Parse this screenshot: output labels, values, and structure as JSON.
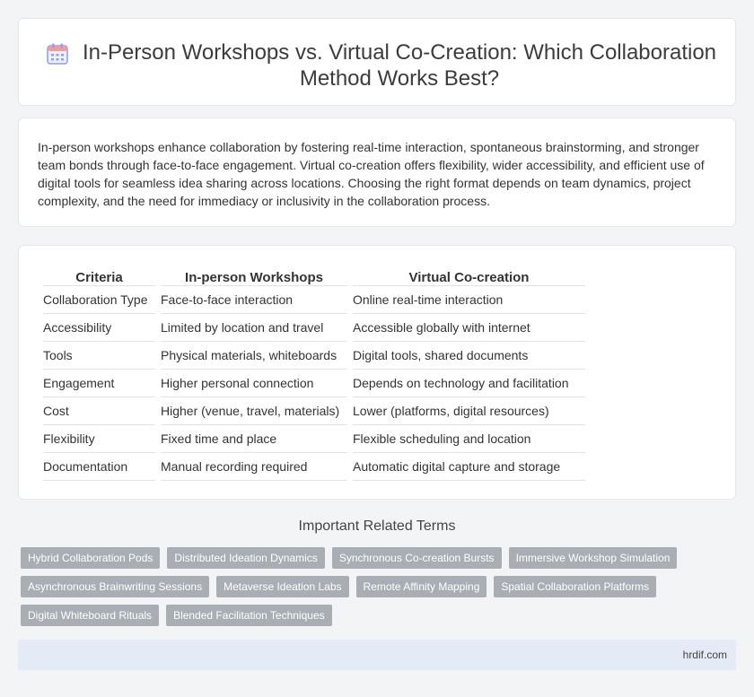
{
  "header": {
    "title": "In-Person Workshops vs. Virtual Co-Creation: Which Collaboration Method Works Best?",
    "icon": "calendar-icon"
  },
  "summary": {
    "text": "In-person workshops enhance collaboration by fostering real-time interaction, spontaneous brainstorming, and stronger team bonds through face-to-face engagement. Virtual co-creation offers flexibility, wider accessibility, and efficient use of digital tools for seamless idea sharing across locations. Choosing the right format depends on team dynamics, project complexity, and the need for immediacy or inclusivity in the collaboration process."
  },
  "table": {
    "headers": [
      "Criteria",
      "In-person Workshops",
      "Virtual Co-creation"
    ],
    "rows": [
      [
        "Collaboration Type",
        "Face-to-face interaction",
        "Online real-time interaction"
      ],
      [
        "Accessibility",
        "Limited by location and travel",
        "Accessible globally with internet"
      ],
      [
        "Tools",
        "Physical materials, whiteboards",
        "Digital tools, shared documents"
      ],
      [
        "Engagement",
        "Higher personal connection",
        "Depends on technology and facilitation"
      ],
      [
        "Cost",
        "Higher (venue, travel, materials)",
        "Lower (platforms, digital resources)"
      ],
      [
        "Flexibility",
        "Fixed time and place",
        "Flexible scheduling and location"
      ],
      [
        "Documentation",
        "Manual recording required",
        "Automatic digital capture and storage"
      ]
    ]
  },
  "related": {
    "title": "Important Related Terms",
    "tags": [
      [
        "Hybrid Collaboration Pods",
        "Distributed Ideation Dynamics",
        "Synchronous Co-creation Bursts",
        "Immersive Workshop Simulation"
      ],
      [
        "Asynchronous Brainwriting Sessions",
        "Metaverse Ideation Labs",
        "Remote Affinity Mapping",
        "Spatial Collaboration Platforms"
      ],
      [
        "Digital Whiteboard Rituals",
        "Blended Facilitation Techniques"
      ]
    ]
  },
  "footer": {
    "site": "hrdif.com"
  },
  "colors": {
    "tag_bg": "#a9adb4",
    "footer_bg": "#e4ebf6",
    "icon_accent": "#7b8ff0"
  }
}
